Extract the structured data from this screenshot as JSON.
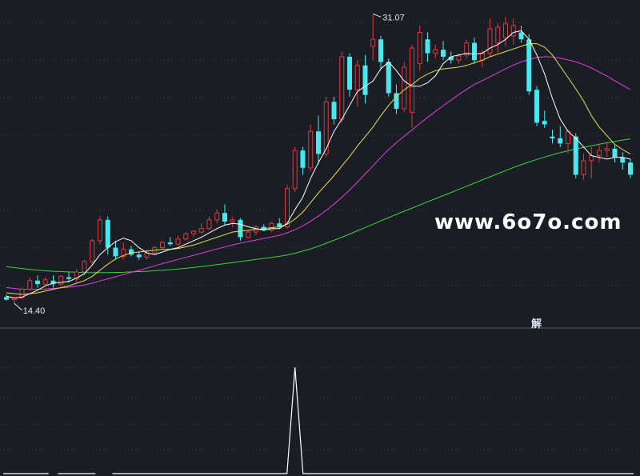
{
  "colors": {
    "background": "#1b1d24",
    "up": "#e0383e",
    "down": "#48e8f0",
    "ma5": "#ffffff",
    "ma10": "#e8e04a",
    "ma20": "#e040e0",
    "ma60": "#3cd43c",
    "indicator": "#ffffff",
    "grid": "#3a3d48",
    "divider": "#555a66"
  },
  "watermark": "www.6o7o.com",
  "signal_label": "解",
  "chart_data": {
    "type": "candlestick",
    "ylim": [
      13.8,
      31.5
    ],
    "high_label": "31.07",
    "low_label": "14.40",
    "candles": [
      {
        "o": 14.75,
        "h": 14.9,
        "l": 14.55,
        "c": 14.6
      },
      {
        "o": 14.6,
        "h": 14.75,
        "l": 14.4,
        "c": 14.7
      },
      {
        "o": 14.7,
        "h": 15.3,
        "l": 14.65,
        "c": 15.2
      },
      {
        "o": 15.2,
        "h": 15.9,
        "l": 15.1,
        "c": 15.7
      },
      {
        "o": 15.7,
        "h": 16.0,
        "l": 15.3,
        "c": 15.5
      },
      {
        "o": 15.5,
        "h": 15.9,
        "l": 15.4,
        "c": 15.75
      },
      {
        "o": 15.7,
        "h": 16.0,
        "l": 15.3,
        "c": 15.5
      },
      {
        "o": 15.5,
        "h": 16.0,
        "l": 15.4,
        "c": 15.95
      },
      {
        "o": 15.9,
        "h": 16.2,
        "l": 15.6,
        "c": 15.8
      },
      {
        "o": 15.8,
        "h": 16.4,
        "l": 15.6,
        "c": 16.2
      },
      {
        "o": 16.2,
        "h": 16.9,
        "l": 16.0,
        "c": 16.8
      },
      {
        "o": 16.8,
        "h": 18.1,
        "l": 16.6,
        "c": 18.0
      },
      {
        "o": 18.0,
        "h": 19.4,
        "l": 17.8,
        "c": 19.2
      },
      {
        "o": 19.2,
        "h": 19.4,
        "l": 17.2,
        "c": 17.6
      },
      {
        "o": 17.6,
        "h": 18.0,
        "l": 16.9,
        "c": 17.1
      },
      {
        "o": 17.1,
        "h": 17.9,
        "l": 16.9,
        "c": 17.5
      },
      {
        "o": 17.5,
        "h": 17.7,
        "l": 17.1,
        "c": 17.2
      },
      {
        "o": 17.2,
        "h": 17.4,
        "l": 16.9,
        "c": 17.05
      },
      {
        "o": 17.05,
        "h": 17.5,
        "l": 16.9,
        "c": 17.3
      },
      {
        "o": 17.3,
        "h": 17.7,
        "l": 17.2,
        "c": 17.6
      },
      {
        "o": 17.6,
        "h": 18.0,
        "l": 17.5,
        "c": 17.9
      },
      {
        "o": 17.9,
        "h": 18.2,
        "l": 17.7,
        "c": 17.8
      },
      {
        "o": 17.8,
        "h": 18.3,
        "l": 17.7,
        "c": 18.1
      },
      {
        "o": 18.1,
        "h": 18.5,
        "l": 18.0,
        "c": 18.4
      },
      {
        "o": 18.4,
        "h": 18.6,
        "l": 18.2,
        "c": 18.55
      },
      {
        "o": 18.5,
        "h": 19.0,
        "l": 18.4,
        "c": 18.7
      },
      {
        "o": 18.7,
        "h": 19.4,
        "l": 18.6,
        "c": 19.2
      },
      {
        "o": 19.2,
        "h": 19.8,
        "l": 19.0,
        "c": 19.6
      },
      {
        "o": 19.6,
        "h": 20.1,
        "l": 18.9,
        "c": 19.1
      },
      {
        "o": 19.1,
        "h": 19.4,
        "l": 18.8,
        "c": 19.2
      },
      {
        "o": 19.2,
        "h": 19.3,
        "l": 18.0,
        "c": 18.2
      },
      {
        "o": 18.2,
        "h": 18.6,
        "l": 18.1,
        "c": 18.5
      },
      {
        "o": 18.5,
        "h": 18.9,
        "l": 18.3,
        "c": 18.8
      },
      {
        "o": 18.8,
        "h": 18.95,
        "l": 18.55,
        "c": 18.6
      },
      {
        "o": 18.6,
        "h": 19.1,
        "l": 18.5,
        "c": 19.0
      },
      {
        "o": 19.0,
        "h": 19.3,
        "l": 18.7,
        "c": 18.8
      },
      {
        "o": 18.8,
        "h": 21.2,
        "l": 18.7,
        "c": 21.0
      },
      {
        "o": 21.0,
        "h": 23.4,
        "l": 20.8,
        "c": 23.2
      },
      {
        "o": 23.2,
        "h": 23.4,
        "l": 21.8,
        "c": 22.2
      },
      {
        "o": 22.2,
        "h": 24.7,
        "l": 22.0,
        "c": 24.3
      },
      {
        "o": 24.3,
        "h": 25.2,
        "l": 22.4,
        "c": 23.0
      },
      {
        "o": 23.0,
        "h": 26.3,
        "l": 22.8,
        "c": 26.0
      },
      {
        "o": 26.0,
        "h": 26.3,
        "l": 24.7,
        "c": 25.0
      },
      {
        "o": 25.0,
        "h": 28.9,
        "l": 24.8,
        "c": 28.6
      },
      {
        "o": 28.6,
        "h": 28.8,
        "l": 26.3,
        "c": 26.7
      },
      {
        "o": 26.7,
        "h": 28.4,
        "l": 25.7,
        "c": 28.1
      },
      {
        "o": 28.1,
        "h": 28.7,
        "l": 25.9,
        "c": 26.4
      },
      {
        "o": 29.2,
        "h": 31.07,
        "l": 28.4,
        "c": 29.6
      },
      {
        "o": 29.6,
        "h": 29.8,
        "l": 27.9,
        "c": 28.3
      },
      {
        "o": 28.3,
        "h": 28.5,
        "l": 26.3,
        "c": 26.5
      },
      {
        "o": 26.5,
        "h": 27.0,
        "l": 25.3,
        "c": 25.6
      },
      {
        "o": 25.6,
        "h": 28.3,
        "l": 25.4,
        "c": 28.0
      },
      {
        "o": 25.4,
        "h": 29.3,
        "l": 24.5,
        "c": 29.1
      },
      {
        "o": 28.2,
        "h": 30.4,
        "l": 27.8,
        "c": 30.0
      },
      {
        "o": 29.6,
        "h": 30.0,
        "l": 28.3,
        "c": 28.8
      },
      {
        "o": 28.8,
        "h": 29.3,
        "l": 28.5,
        "c": 29.0
      },
      {
        "o": 29.0,
        "h": 29.5,
        "l": 28.4,
        "c": 28.6
      },
      {
        "o": 28.6,
        "h": 28.9,
        "l": 28.2,
        "c": 28.4
      },
      {
        "o": 28.4,
        "h": 28.8,
        "l": 28.2,
        "c": 28.65
      },
      {
        "o": 28.7,
        "h": 29.6,
        "l": 28.5,
        "c": 29.4
      },
      {
        "o": 29.4,
        "h": 29.7,
        "l": 28.2,
        "c": 28.4
      },
      {
        "o": 28.4,
        "h": 29.0,
        "l": 28.0,
        "c": 28.8
      },
      {
        "o": 28.8,
        "h": 30.8,
        "l": 28.6,
        "c": 30.2
      },
      {
        "o": 29.4,
        "h": 30.5,
        "l": 28.8,
        "c": 30.3
      },
      {
        "o": 29.7,
        "h": 30.9,
        "l": 29.2,
        "c": 30.5
      },
      {
        "o": 29.8,
        "h": 30.8,
        "l": 29.3,
        "c": 30.4
      },
      {
        "o": 30.0,
        "h": 30.4,
        "l": 29.4,
        "c": 29.6
      },
      {
        "o": 29.6,
        "h": 29.9,
        "l": 26.4,
        "c": 26.6
      },
      {
        "o": 26.7,
        "h": 26.9,
        "l": 24.6,
        "c": 24.8
      },
      {
        "o": 24.9,
        "h": 25.5,
        "l": 24.5,
        "c": 24.7
      },
      {
        "o": 24.0,
        "h": 24.4,
        "l": 23.6,
        "c": 23.9
      },
      {
        "o": 23.9,
        "h": 24.6,
        "l": 23.4,
        "c": 23.6
      },
      {
        "o": 23.6,
        "h": 24.4,
        "l": 23.0,
        "c": 24.3
      },
      {
        "o": 24.0,
        "h": 24.2,
        "l": 21.6,
        "c": 21.8
      },
      {
        "o": 21.8,
        "h": 23.0,
        "l": 21.5,
        "c": 22.6
      },
      {
        "o": 22.6,
        "h": 23.4,
        "l": 21.6,
        "c": 22.9
      },
      {
        "o": 22.9,
        "h": 23.6,
        "l": 22.5,
        "c": 23.2
      },
      {
        "o": 23.2,
        "h": 23.7,
        "l": 22.8,
        "c": 23.3
      },
      {
        "o": 23.3,
        "h": 23.5,
        "l": 22.5,
        "c": 22.8
      },
      {
        "o": 22.8,
        "h": 23.1,
        "l": 22.1,
        "c": 22.5
      },
      {
        "o": 22.5,
        "h": 22.7,
        "l": 21.6,
        "c": 21.8
      }
    ],
    "ma5": [
      14.8,
      14.7,
      14.75,
      14.95,
      15.15,
      15.4,
      15.55,
      15.6,
      15.65,
      15.85,
      16.1,
      16.6,
      17.2,
      17.6,
      17.95,
      18.15,
      18.0,
      17.6,
      17.3,
      17.2,
      17.35,
      17.5,
      17.6,
      17.8,
      18.0,
      18.2,
      18.45,
      18.7,
      18.9,
      19.0,
      18.95,
      18.8,
      18.7,
      18.6,
      18.7,
      18.7,
      19.0,
      19.8,
      20.5,
      21.6,
      22.5,
      23.3,
      24.3,
      25.0,
      25.8,
      26.6,
      26.9,
      27.2,
      27.9,
      28.3,
      27.8,
      27.2,
      26.9,
      26.9,
      27.1,
      27.5,
      28.2,
      28.6,
      28.7,
      28.8,
      28.75,
      28.8,
      29.1,
      29.3,
      29.6,
      30.0,
      30.1,
      29.6,
      28.7,
      27.6,
      26.2,
      25.0,
      24.3,
      23.9,
      23.4,
      22.9,
      22.8,
      22.7,
      22.8,
      22.8,
      22.7
    ],
    "ma10": [
      15.0,
      14.95,
      14.9,
      14.95,
      15.0,
      15.1,
      15.2,
      15.3,
      15.4,
      15.55,
      15.7,
      15.95,
      16.3,
      16.65,
      16.95,
      17.15,
      17.3,
      17.35,
      17.4,
      17.45,
      17.5,
      17.5,
      17.55,
      17.65,
      17.75,
      17.9,
      18.05,
      18.2,
      18.35,
      18.5,
      18.55,
      18.6,
      18.65,
      18.7,
      18.75,
      18.8,
      18.95,
      19.25,
      19.65,
      20.2,
      20.75,
      21.25,
      21.75,
      22.3,
      22.85,
      23.45,
      24.0,
      24.55,
      25.2,
      25.8,
      26.3,
      26.7,
      27.0,
      27.35,
      27.6,
      27.8,
      27.9,
      27.95,
      28.0,
      28.1,
      28.25,
      28.4,
      28.6,
      28.75,
      28.9,
      29.05,
      29.2,
      29.35,
      29.35,
      29.15,
      28.7,
      28.05,
      27.4,
      26.75,
      26.05,
      25.2,
      24.55,
      24.05,
      23.55,
      23.25,
      23.0
    ],
    "ma20": [
      15.3,
      15.25,
      15.2,
      15.2,
      15.2,
      15.22,
      15.25,
      15.28,
      15.32,
      15.38,
      15.45,
      15.55,
      15.68,
      15.8,
      15.92,
      16.05,
      16.18,
      16.3,
      16.42,
      16.55,
      16.68,
      16.8,
      16.92,
      17.04,
      17.16,
      17.28,
      17.4,
      17.52,
      17.64,
      17.76,
      17.86,
      17.95,
      18.04,
      18.13,
      18.22,
      18.31,
      18.45,
      18.63,
      18.85,
      19.12,
      19.42,
      19.75,
      20.1,
      20.5,
      20.92,
      21.38,
      21.85,
      22.32,
      22.8,
      23.25,
      23.65,
      24.02,
      24.38,
      24.75,
      25.1,
      25.45,
      25.78,
      26.1,
      26.42,
      26.72,
      27.0,
      27.22,
      27.45,
      27.68,
      27.9,
      28.12,
      28.3,
      28.45,
      28.55,
      28.6,
      28.58,
      28.52,
      28.42,
      28.3,
      28.15,
      27.95,
      27.72,
      27.48,
      27.22,
      26.95,
      26.7
    ],
    "ma60": [
      16.5,
      16.45,
      16.4,
      16.35,
      16.3,
      16.27,
      16.24,
      16.22,
      16.2,
      16.18,
      16.17,
      16.16,
      16.16,
      16.16,
      16.17,
      16.18,
      16.2,
      16.22,
      16.24,
      16.27,
      16.3,
      16.33,
      16.37,
      16.41,
      16.46,
      16.51,
      16.56,
      16.62,
      16.68,
      16.74,
      16.8,
      16.86,
      16.92,
      16.98,
      17.04,
      17.1,
      17.18,
      17.28,
      17.4,
      17.53,
      17.68,
      17.85,
      18.02,
      18.2,
      18.38,
      18.57,
      18.76,
      18.95,
      19.14,
      19.33,
      19.52,
      19.7,
      19.88,
      20.06,
      20.24,
      20.42,
      20.6,
      20.78,
      20.96,
      21.14,
      21.32,
      21.5,
      21.68,
      21.86,
      22.04,
      22.22,
      22.38,
      22.54,
      22.68,
      22.82,
      22.95,
      23.07,
      23.18,
      23.28,
      23.38,
      23.47,
      23.56,
      23.64,
      23.72,
      23.8,
      23.87
    ],
    "indicator": {
      "ylim": [
        0,
        1
      ],
      "spike_index": 37,
      "spike_value": 0.82,
      "baseline_segments": [
        [
          0,
          5
        ],
        [
          7,
          11
        ],
        [
          14,
          80
        ]
      ]
    }
  }
}
